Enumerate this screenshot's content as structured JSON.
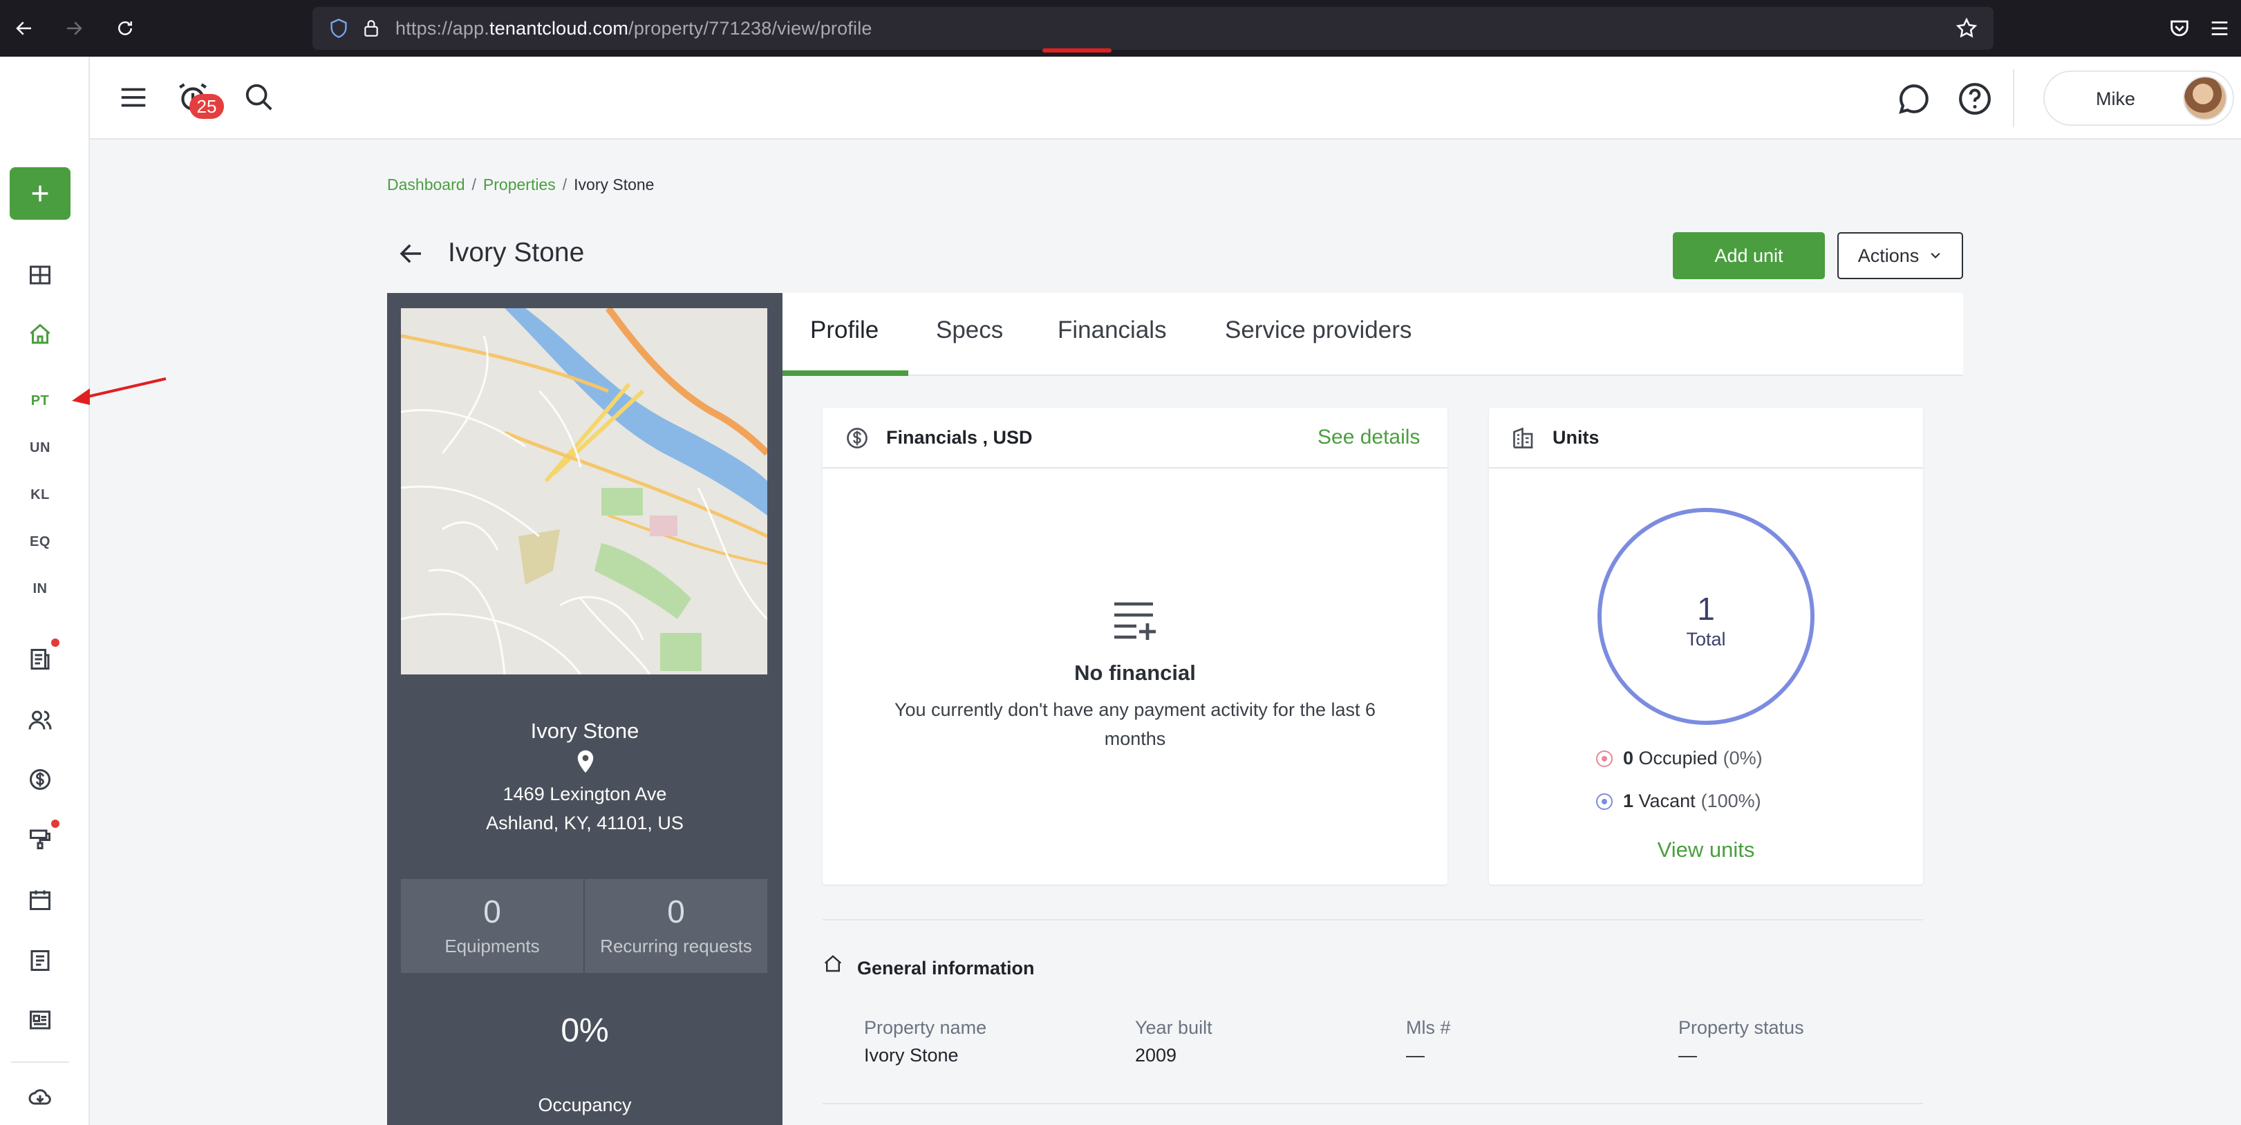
{
  "browser": {
    "url_prefix": "https://app.",
    "url_domain": "tenantcloud.com",
    "url_path": "/property/771238/view/profile"
  },
  "header": {
    "notifications_count": "25",
    "user_name": "Mike"
  },
  "rail": {
    "sub_items": [
      "PT",
      "UN",
      "KL",
      "EQ",
      "IN"
    ]
  },
  "breadcrumb": {
    "items": [
      "Dashboard",
      "Properties",
      "Ivory Stone"
    ],
    "separator": "/"
  },
  "page": {
    "title": "Ivory Stone",
    "add_unit_label": "Add unit",
    "actions_label": "Actions"
  },
  "property": {
    "name": "Ivory Stone",
    "address_line1": "1469 Lexington Ave",
    "address_line2": "Ashland, KY, 41101, US",
    "equipments_count": "0",
    "equipments_label": "Equipments",
    "recurring_count": "0",
    "recurring_label": "Recurring requests",
    "occupancy_pct": "0%",
    "occupancy_label": "Occupancy"
  },
  "tabs": [
    "Profile",
    "Specs",
    "Financials",
    "Service providers"
  ],
  "financials": {
    "title": "Financials , USD",
    "see_details": "See details",
    "empty_title": "No financial",
    "empty_text": "You currently don't have any payment activity for the last 6 months"
  },
  "units": {
    "title": "Units",
    "total": "1",
    "total_label": "Total",
    "occupied_count": "0",
    "occupied_label": "Occupied",
    "occupied_pct": "(0%)",
    "vacant_count": "1",
    "vacant_label": "Vacant",
    "vacant_pct": "(100%)",
    "view_units": "View units",
    "occupied_fraction": 0,
    "vacant_fraction": 1,
    "colors": {
      "vacant": "#7b8ce0",
      "occupied": "#e8879a"
    }
  },
  "general_info": {
    "title": "General information",
    "fields": [
      {
        "label": "Property name",
        "value": "Ivory Stone"
      },
      {
        "label": "Year built",
        "value": "2009"
      },
      {
        "label": "Mls #",
        "value": "—"
      },
      {
        "label": "Property status",
        "value": "—"
      }
    ]
  },
  "colors": {
    "accent": "#4a9e3f",
    "panel": "#4b515c",
    "badge": "#e53e3e"
  }
}
